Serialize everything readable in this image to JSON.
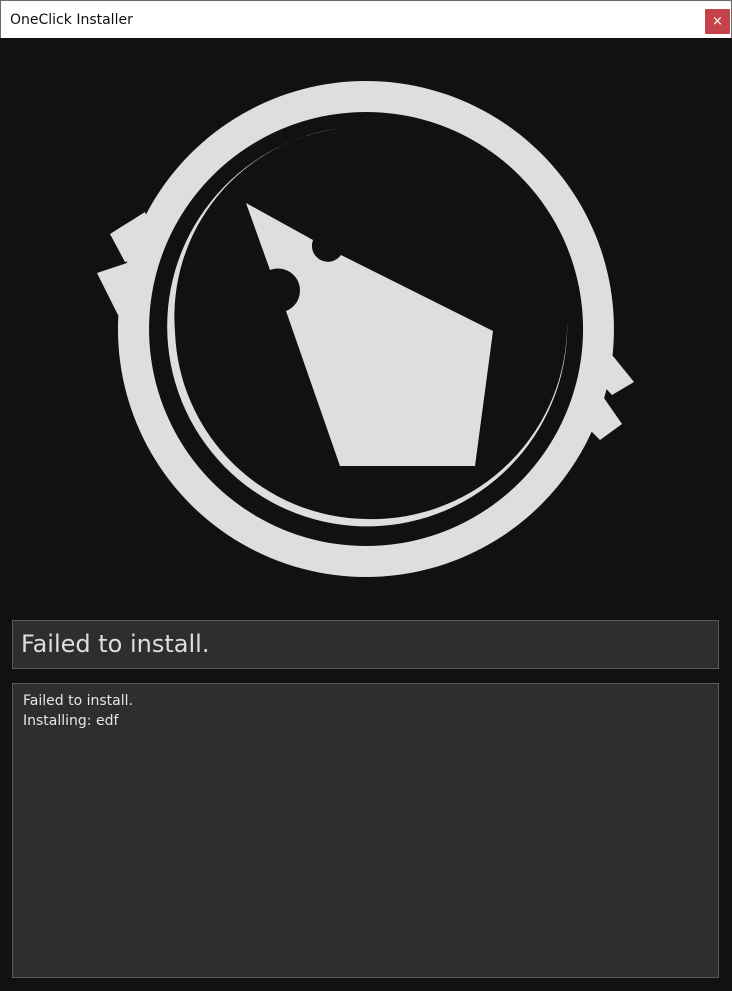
{
  "window": {
    "title": "OneClick Installer",
    "close_label": "×"
  },
  "logo": {
    "icon": "pen-nib-logo",
    "color": "#dedede",
    "background": "#111111"
  },
  "status": {
    "text": "Failed to install."
  },
  "log": {
    "lines": [
      "Failed to install.",
      "Installing: edf"
    ]
  },
  "colors": {
    "close_button": "#c4434a",
    "panel_background": "#2e2e2e",
    "panel_border": "#5a5a5a",
    "text": "#dedede"
  }
}
